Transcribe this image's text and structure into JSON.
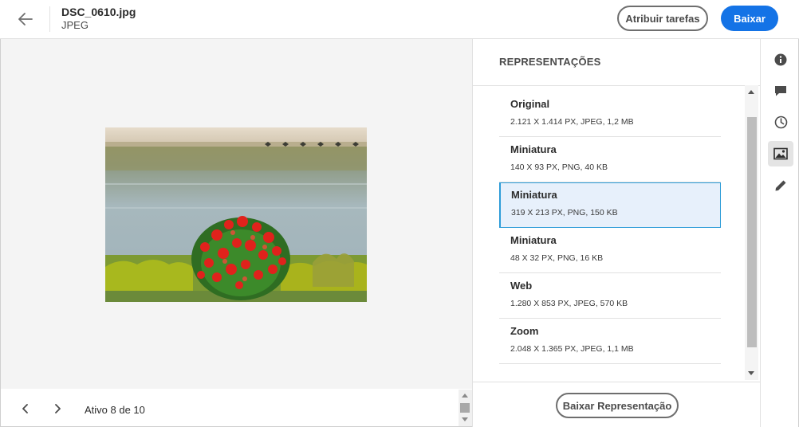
{
  "header": {
    "file_name": "DSC_0610.jpg",
    "file_type": "JPEG",
    "assign_label": "Atribuir tarefas",
    "download_label": "Baixar"
  },
  "navigation": {
    "status": "Ativo 8 de 10"
  },
  "panel": {
    "title": "REPRESENTAÇÕES",
    "renditions": [
      {
        "name": "Original",
        "info": "2.121 X 1.414 PX, JPEG, 1,2 MB"
      },
      {
        "name": "Miniatura",
        "info": "140 X 93 PX, PNG, 40 KB"
      },
      {
        "name": "Miniatura",
        "info": "319 X 213 PX, PNG, 150 KB"
      },
      {
        "name": "Miniatura",
        "info": "48 X 32 PX, PNG, 16 KB"
      },
      {
        "name": "Web",
        "info": "1.280 X 853 PX, JPEG, 570 KB"
      },
      {
        "name": "Zoom",
        "info": "2.048 X 1.365 PX, JPEG, 1,1 MB"
      }
    ],
    "selected_index": 2,
    "download_rendition_label": "Baixar Representação"
  },
  "rail": {
    "icons": [
      "info-icon",
      "comment-icon",
      "history-icon",
      "renditions-icon",
      "edit-icon"
    ],
    "active": "renditions-icon"
  },
  "colors": {
    "accent": "#1473e6",
    "selected_bg": "#e7f0fb",
    "selected_border": "#2d9cd8"
  }
}
